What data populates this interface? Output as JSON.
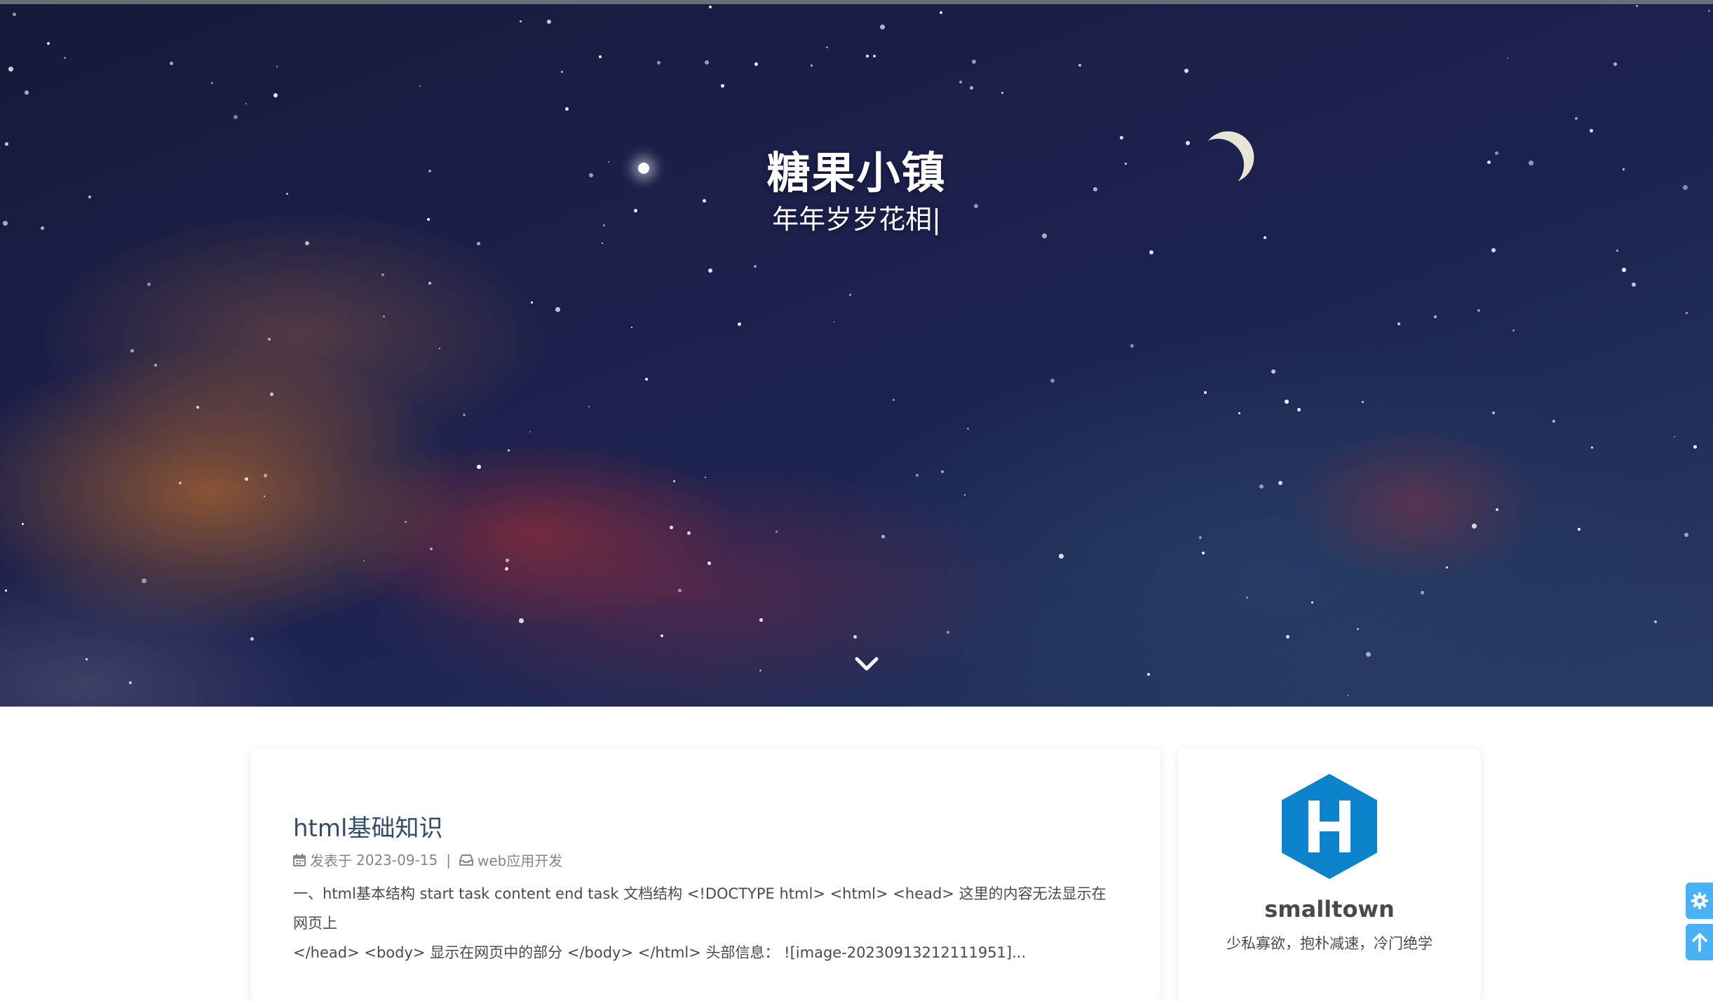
{
  "site": {
    "title": "糖果小镇",
    "subtitle": "年年岁岁花相|"
  },
  "icons": {
    "scroll_down": "chevron-down-icon",
    "calendar": "calendar-icon",
    "category": "inbox-icon",
    "avatar": "hexo-h-logo",
    "settings": "gear-icon",
    "back_to_top": "arrow-up-icon"
  },
  "post": {
    "title": "html基础知识",
    "date_label": "发表于",
    "date": "2023-09-15",
    "separator": "|",
    "category": "web应用开发",
    "excerpt_line1": "一、html基本结构 start task content end task 文档结构 <!DOCTYPE html> <html> <head> 这里的内容无法显示在网页上",
    "excerpt_line2": "</head> <body> 显示在网页中的部分 </body> </html> 头部信息： ![image-20230913212111951]..."
  },
  "author": {
    "name": "smalltown",
    "description": "少私寡欲，抱朴减速，冷门绝学"
  },
  "colors": {
    "accent": "#49b1f5",
    "avatar_blue": "#0e83cd",
    "title_text": "#344c67",
    "body_text": "#4c4948",
    "meta_text": "#858585"
  }
}
